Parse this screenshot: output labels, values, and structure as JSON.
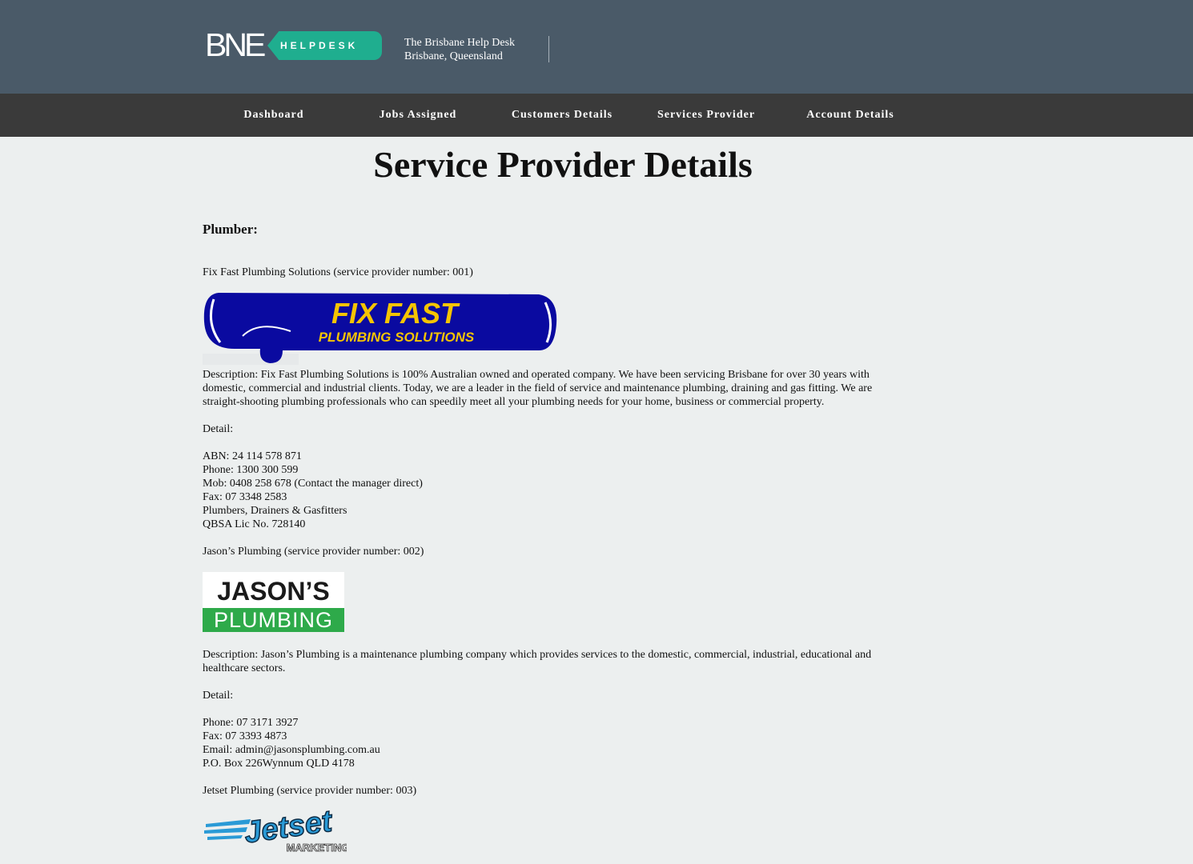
{
  "header": {
    "logo_text": "BNE",
    "logo_badge": "HELPDESK",
    "tagline_line1": "The Brisbane Help Desk",
    "tagline_line2": "Brisbane, Queensland"
  },
  "nav": {
    "items": [
      {
        "label": "Dashboard"
      },
      {
        "label": "Jobs Assigned"
      },
      {
        "label": "Customers Details"
      },
      {
        "label": "Services Provider"
      },
      {
        "label": "Account Details"
      }
    ]
  },
  "main": {
    "title": "Service Provider Details",
    "section_heading": "Plumber:",
    "providers": [
      {
        "name": "Fix Fast Plumbing Solutions (service provider number: 001)",
        "logo_line1": "FIX FAST",
        "logo_line2": "PLUMBING SOLUTIONS",
        "description": "Description: Fix Fast Plumbing Solutions is 100% Australian owned and operated company. We have been servicing Brisbane for over 30 years with domestic, commercial and industrial clients. Today, we are a leader in the field of service and maintenance plumbing, draining and gas fitting. We are straight-shooting plumbing professionals who can speedily meet all your plumbing needs for your home, business or commercial property.",
        "detail_label": "Detail:",
        "details": [
          "ABN: 24 114 578 871",
          "Phone: 1300 300 599",
          "Mob: 0408 258 678 (Contact the manager direct)",
          "Fax: 07 3348 2583",
          "Plumbers, Drainers & Gasfitters",
          "QBSA Lic No. 728140"
        ]
      },
      {
        "name": "Jason’s Plumbing (service provider number: 002)",
        "logo_line1": "JASON’S",
        "logo_line2": "PLUMBING",
        "description": "Description: Jason’s Plumbing is a maintenance plumbing company which provides services to the domestic, commercial, industrial, educational and healthcare sectors.",
        "detail_label": "Detail:",
        "details": [
          "Phone: 07 3171 3927",
          "Fax: 07 3393 4873",
          "Email: admin@jasonsplumbing.com.au",
          "P.O. Box 226Wynnum QLD 4178"
        ]
      },
      {
        "name": "Jetset Plumbing (service provider number: 003)",
        "logo_line1": "Jetset",
        "logo_line2": "MARKETING"
      }
    ]
  },
  "colors": {
    "header_bg": "#4a5a68",
    "nav_bg": "#3a3a3a",
    "page_bg": "#ecefef",
    "badge_green": "#1fae8f",
    "fixfast_blue": "#0a0aa0",
    "fixfast_yellow": "#f5c400",
    "jasons_green": "#2eaa4a"
  }
}
